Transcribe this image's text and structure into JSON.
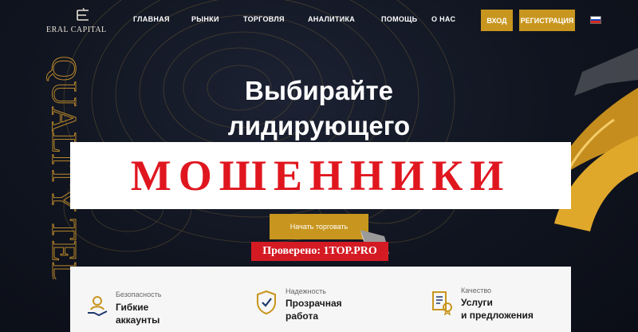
{
  "brand": {
    "logo_text": "ERAL CAPITAL"
  },
  "nav": {
    "items": [
      {
        "label": "ГЛАВНАЯ"
      },
      {
        "label": "РЫНКИ"
      },
      {
        "label": "ТОРГОВЛЯ"
      },
      {
        "label": "АНАЛИТИКА"
      },
      {
        "label": "ПОМОЩЬ"
      },
      {
        "label": "О НАС"
      }
    ],
    "login_label": "ВХОД",
    "register_label": "РЕГИСТРАЦИЯ",
    "language": "ru"
  },
  "side_text": "QUALITY TED",
  "hero": {
    "headline_line1": "Выбирайте",
    "headline_line2": "лидирующего",
    "cta_label": "Начать торговать"
  },
  "overlay": {
    "scam_label": "МОШЕННИКИ",
    "verified_label": "Проверено: 1TOP.PRO"
  },
  "features": [
    {
      "caption": "Безопасность",
      "title_line1": "Гибкие",
      "title_line2": "аккаунты",
      "icon": "user-hand-icon"
    },
    {
      "caption": "Надежность",
      "title_line1": "Прозрачная",
      "title_line2": "работа",
      "icon": "shield-check-icon"
    },
    {
      "caption": "Качество",
      "title_line1": "Услуги",
      "title_line2": "и предложения",
      "icon": "document-badge-icon"
    }
  ],
  "colors": {
    "accent": "#c8961e",
    "scam_red": "#e0161f",
    "verified_red": "#d41b24",
    "background": "#10141f"
  }
}
